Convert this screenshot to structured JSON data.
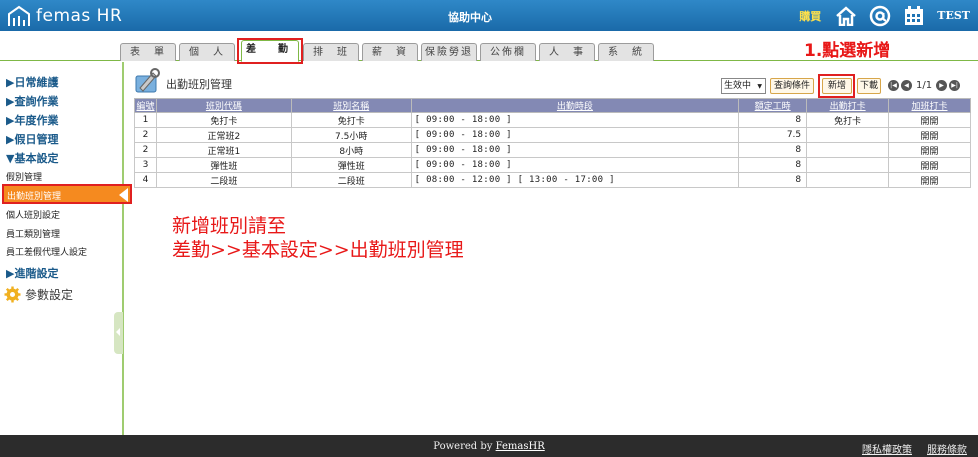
{
  "header": {
    "brand": "femas HR",
    "title": "協助中心",
    "purchase_label": "購買",
    "user": "TEST",
    "icons": [
      "home-icon",
      "at-icon",
      "calendar-icon"
    ],
    "bg_color": "#1f74b4"
  },
  "tabs": [
    "表　單",
    "個　人",
    "差　勤",
    "排　班",
    "薪　資",
    "保險勞退",
    "公佈欄",
    "人　事",
    "系　統"
  ],
  "active_tab": "差　勤",
  "annotation_step": "1.點選新增",
  "sidebar": {
    "daily": "▶日常維護",
    "query": "▶查詢作業",
    "annual": "▶年度作業",
    "holiday": "▶假日管理",
    "basic": "▼基本設定",
    "sub": {
      "leave_type": "假別管理",
      "shift_class": "出勤班別管理",
      "personal_shift": "個人班別設定",
      "employee_category": "員工類別管理",
      "agent": "員工差假代理人設定"
    },
    "advanced": "▶進階設定",
    "params": "參數設定"
  },
  "main": {
    "title": "出勤班別管理",
    "status_select": "生效中",
    "query_btn": "查詢條件",
    "new_btn": "新增",
    "download_btn": "下載",
    "page": "1/1",
    "columns": [
      "編號",
      "班別代碼",
      "班別名稱",
      "出勤時段",
      "額定工時",
      "出勤打卡",
      "加班打卡"
    ],
    "rows": [
      [
        "1",
        "免打卡",
        "免打卡",
        "[ 09:00 - 18:00 ]",
        "8",
        "免打卡",
        "開開"
      ],
      [
        "2",
        "正常班2",
        "7.5小時",
        "[ 09:00 - 18:00 ]",
        "7.5",
        "",
        "開開"
      ],
      [
        "2",
        "正常班1",
        "8小時",
        "[ 09:00 - 18:00 ]",
        "8",
        "",
        "開開"
      ],
      [
        "3",
        "彈性班",
        "彈性班",
        "[ 09:00 - 18:00 ]",
        "8",
        "",
        "開開"
      ],
      [
        "4",
        "二段班",
        "二段班",
        "[ 08:00 - 12:00 ] [ 13:00 - 17:00 ]",
        "8",
        "",
        "開開"
      ]
    ]
  },
  "annotation_note": {
    "line1": "新增班別請至",
    "line2": "差勤>>基本設定>>出勤班別管理"
  },
  "footer": {
    "powered": "Powered by ",
    "powered_link": "FemasHR",
    "privacy": "隱私權政策",
    "terms": "服務條款"
  },
  "colors": {
    "accent_green": "#7fb846",
    "highlight_red": "#e02020",
    "active_orange": "#f58a1f",
    "table_header": "#8389b4"
  }
}
